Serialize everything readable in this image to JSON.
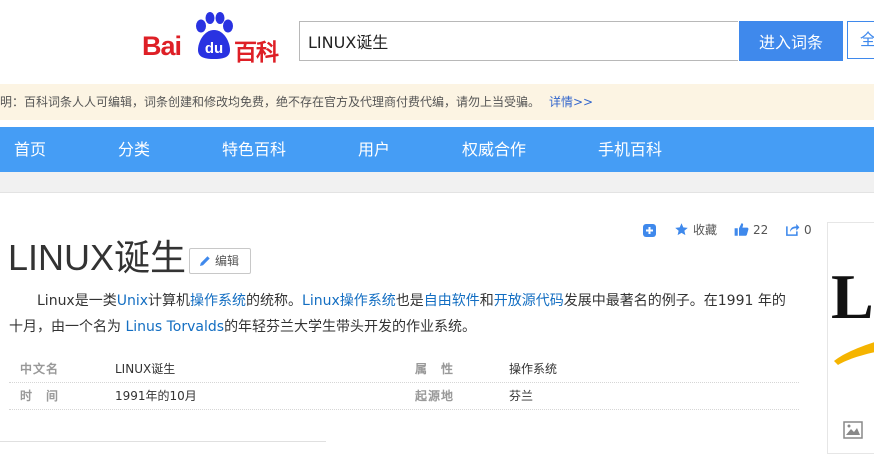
{
  "header": {
    "logo": {
      "part1": "Bai",
      "part2": "du",
      "part3": "百科"
    },
    "search": {
      "value": "LINUX诞生",
      "placeholder": ""
    },
    "search_button": "进入词条",
    "search_button2": "全"
  },
  "notice": {
    "text": "声明：百科词条人人可编辑，词条创建和修改均免费，绝不存在官方及代理商付费代编，请勿上当受骗。",
    "more": "详情>>"
  },
  "nav": {
    "items": [
      {
        "label": "首页"
      },
      {
        "label": "分类"
      },
      {
        "label": "特色百科"
      },
      {
        "label": "用户"
      },
      {
        "label": "权威合作"
      },
      {
        "label": "手机百科"
      }
    ]
  },
  "tools": {
    "favorite": "收藏",
    "likes": "22",
    "shares": "0"
  },
  "article": {
    "title": "LINUX诞生",
    "edit_label": "编辑",
    "summary": {
      "t1": "Linux是一类",
      "l1": "Unix",
      "t2": "计算机",
      "l2": "操作系统",
      "t3": "的统称。",
      "l3": "Linux操作系统",
      "t4": "也是",
      "l4": "自由软件",
      "t5": "和",
      "l5": "开放源代码",
      "t6": "发展中最著名的例子。在1991 年的十月，由一个名为",
      "l6": "Linus Torvalds",
      "t7": "的年轻芬兰大学生带头开发的作业系统。"
    }
  },
  "basic_info": {
    "rows": [
      {
        "k1": "中文名",
        "v1": "LINUX诞生",
        "k2": "属　性",
        "v2": "操作系统"
      },
      {
        "k1": "时　间",
        "v1": "1991年的10月",
        "k2": "起源地",
        "v2": "芬兰"
      }
    ]
  },
  "side_image": {
    "letter": "L"
  },
  "colors": {
    "brand_red": "#de1f26",
    "brand_blue": "#2932e1",
    "nav_blue": "#459df5",
    "button_blue": "#3f89ec",
    "link_blue": "#136ec2",
    "notice_bg": "#fcf4e3"
  }
}
